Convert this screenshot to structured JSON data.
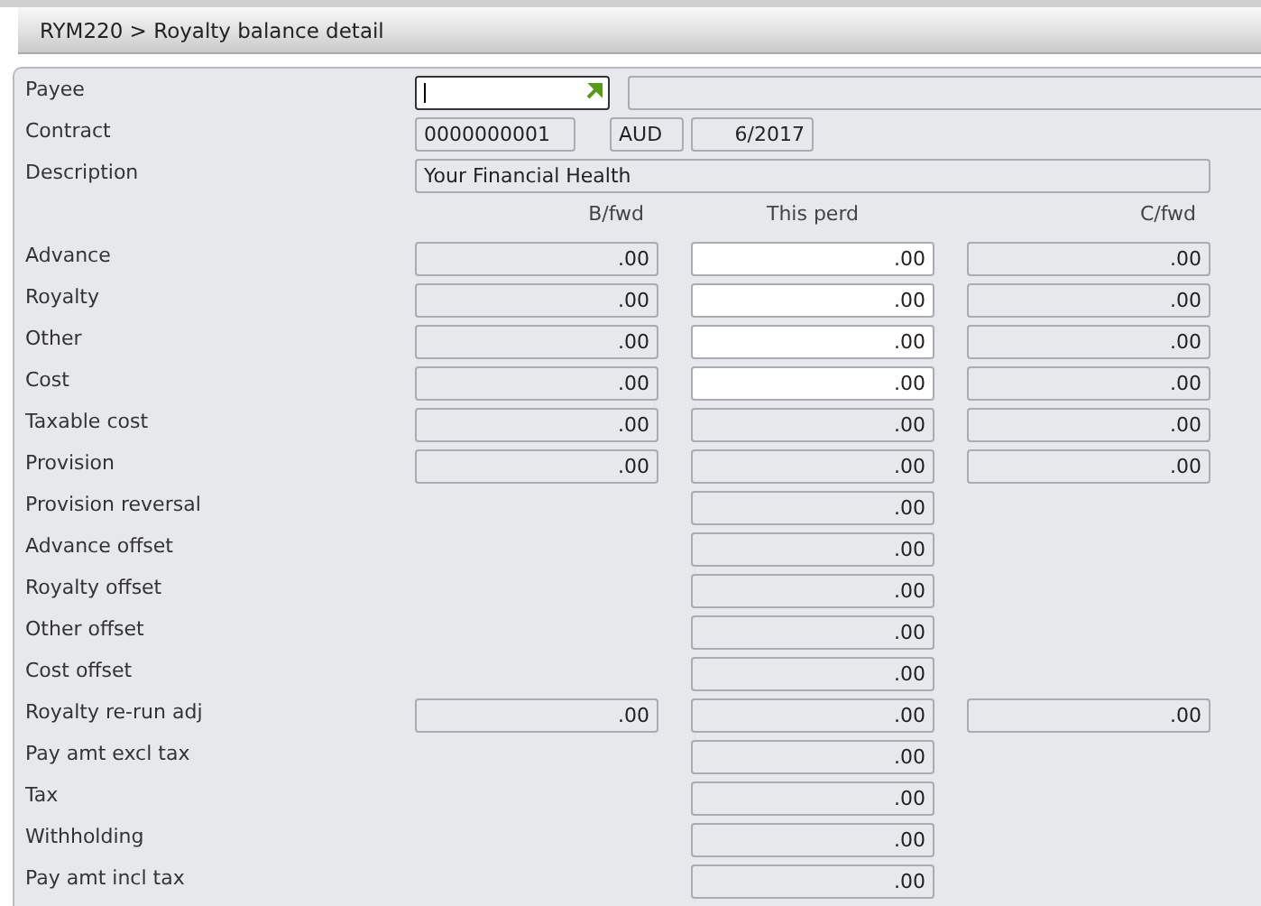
{
  "window": {
    "title": "RYM220 > Royalty balance detail"
  },
  "header": {
    "payee": {
      "label": "Payee",
      "focused": true,
      "editable": true
    },
    "contract": {
      "label": "Contract",
      "number": "0000000001",
      "currency": "AUD",
      "period": "6/2017"
    },
    "description": {
      "label": "Description",
      "value": "Your Financial Health"
    }
  },
  "columns": [
    "B/fwd",
    "This perd",
    "C/fwd"
  ],
  "rows": [
    {
      "label": "Advance",
      "cells": [
        {
          "value": ".00",
          "editable": false
        },
        {
          "value": ".00",
          "editable": true
        },
        {
          "value": ".00",
          "editable": false
        }
      ]
    },
    {
      "label": "Royalty",
      "cells": [
        {
          "value": ".00",
          "editable": false
        },
        {
          "value": ".00",
          "editable": true
        },
        {
          "value": ".00",
          "editable": false
        }
      ]
    },
    {
      "label": "Other",
      "cells": [
        {
          "value": ".00",
          "editable": false
        },
        {
          "value": ".00",
          "editable": true
        },
        {
          "value": ".00",
          "editable": false
        }
      ]
    },
    {
      "label": "Cost",
      "cells": [
        {
          "value": ".00",
          "editable": false
        },
        {
          "value": ".00",
          "editable": true
        },
        {
          "value": ".00",
          "editable": false
        }
      ]
    },
    {
      "label": "Taxable cost",
      "cells": [
        {
          "value": ".00",
          "editable": false
        },
        {
          "value": ".00",
          "editable": false
        },
        {
          "value": ".00",
          "editable": false
        }
      ]
    },
    {
      "label": "Provision",
      "cells": [
        {
          "value": ".00",
          "editable": false
        },
        {
          "value": ".00",
          "editable": false
        },
        {
          "value": ".00",
          "editable": false
        }
      ]
    },
    {
      "label": "Provision reversal",
      "cells": [
        null,
        {
          "value": ".00",
          "editable": false
        },
        null
      ]
    },
    {
      "label": "Advance offset",
      "cells": [
        null,
        {
          "value": ".00",
          "editable": false
        },
        null
      ]
    },
    {
      "label": "Royalty offset",
      "cells": [
        null,
        {
          "value": ".00",
          "editable": false
        },
        null
      ]
    },
    {
      "label": "Other offset",
      "cells": [
        null,
        {
          "value": ".00",
          "editable": false
        },
        null
      ]
    },
    {
      "label": "Cost offset",
      "cells": [
        null,
        {
          "value": ".00",
          "editable": false
        },
        null
      ]
    },
    {
      "label": "Royalty re-run adj",
      "cells": [
        {
          "value": ".00",
          "editable": false
        },
        {
          "value": ".00",
          "editable": false
        },
        {
          "value": ".00",
          "editable": false
        }
      ]
    },
    {
      "label": "Pay amt excl tax",
      "cells": [
        null,
        {
          "value": ".00",
          "editable": false
        },
        null
      ]
    },
    {
      "label": "Tax",
      "cells": [
        null,
        {
          "value": ".00",
          "editable": false
        },
        null
      ]
    },
    {
      "label": "Withholding",
      "cells": [
        null,
        {
          "value": ".00",
          "editable": false
        },
        null
      ]
    },
    {
      "label": "Pay amt incl tax",
      "cells": [
        null,
        {
          "value": ".00",
          "editable": false
        },
        null
      ]
    }
  ]
}
